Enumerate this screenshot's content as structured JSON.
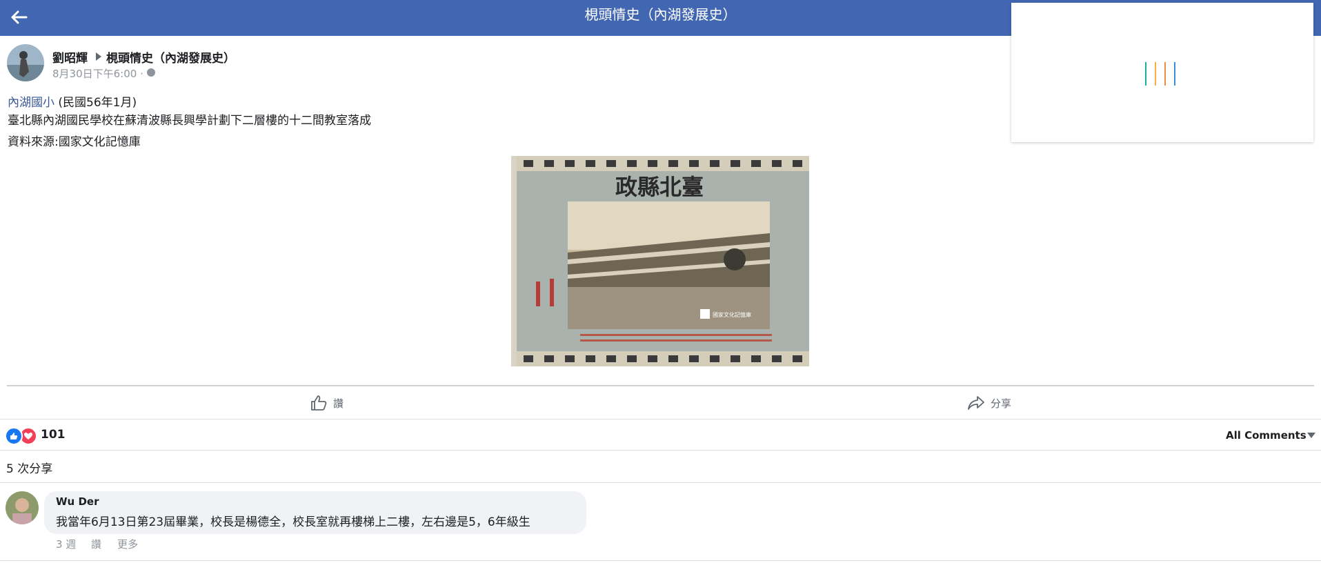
{
  "header": {
    "title": "梘頭情史（內湖發展史）"
  },
  "post": {
    "author": "劉昭輝",
    "group": "梘頭情史（內湖發展史）",
    "time": "8月30日下午6:00 ·",
    "line1_link": "內湖國小",
    "line1_rest": " (民國56年1月)",
    "line2": "臺北縣內湖國民學校在蘇清波縣長興學計劃下二層樓的十二間教室落成",
    "line3": "資料來源:國家文化記憶庫",
    "photo": {
      "banner_text": "政縣北臺",
      "watermark": "國家文化記憶庫"
    }
  },
  "actions": {
    "like": "讚",
    "share": "分享"
  },
  "stats": {
    "reaction_count": "101",
    "all_comments": "All Comments",
    "shares": "5 次分享"
  },
  "comment": {
    "author": "Wu Der",
    "text": "我當年6月13日第23屆畢業，校長是楊德全，校長室就再樓梯上二樓，左右邊是5，6年級生",
    "time": "3 週",
    "like": "讚",
    "more": "更多"
  },
  "colors": {
    "header_bg": "#4267b2",
    "link": "#385898",
    "like_blue": "#1877f2",
    "love_red": "#f33e58",
    "loader_bars": [
      "#1ab0a0",
      "#f5b041",
      "#f0884a",
      "#3c8dd8"
    ]
  },
  "icons": {
    "back": "back-arrow-icon",
    "like": "thumbs-up-icon",
    "share": "share-arrow-icon",
    "privacy": "globe-icon",
    "sort": "caret-down-icon"
  }
}
